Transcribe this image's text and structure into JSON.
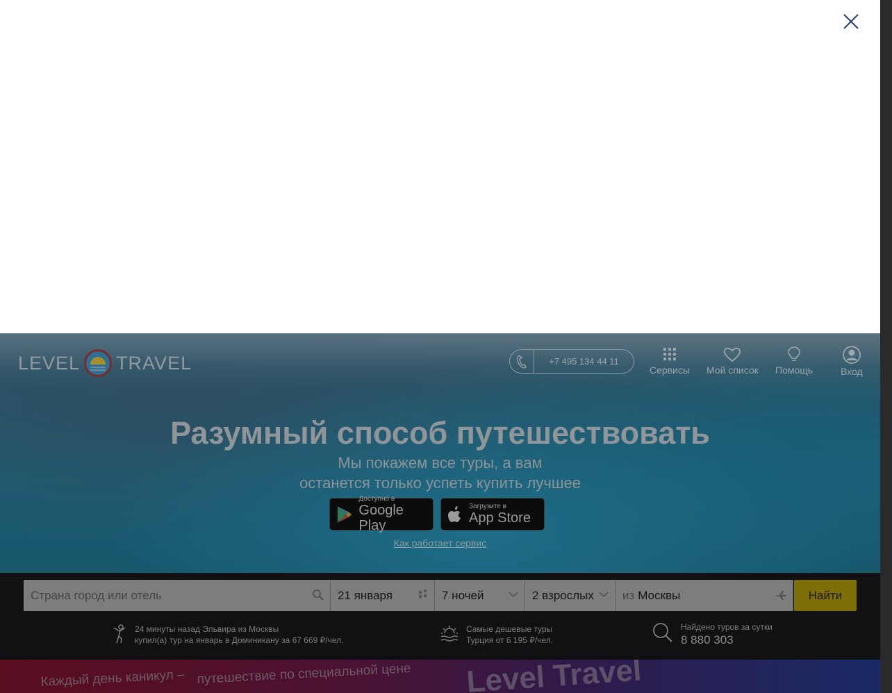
{
  "header": {
    "logo_left": "LEVEL",
    "logo_right": "TRAVEL",
    "phone": "+7 495 134 44 11",
    "nav": [
      {
        "label": "Сервисы",
        "icon": "grid-icon"
      },
      {
        "label": "Мой список",
        "icon": "heart-icon"
      },
      {
        "label": "Помощь",
        "icon": "lightbulb-icon"
      },
      {
        "label": "Вход",
        "icon": "user-icon"
      }
    ]
  },
  "hero": {
    "title": "Разумный способ путешествовать",
    "subtitle_line1": "Мы покажем все туры, а вам",
    "subtitle_line2": "останется только успеть купить лучшее",
    "google_play": {
      "small": "Доступно в",
      "big": "Google Play"
    },
    "app_store": {
      "small": "Загрузите в",
      "big": "App Store"
    },
    "how_link": "Как работает сервис"
  },
  "search": {
    "destination_placeholder": "Страна город или отель",
    "date": "21 января",
    "nights": "7 ночей",
    "guests": "2 взрослых",
    "from_prefix": "из",
    "from_city": "Москвы",
    "submit": "Найти"
  },
  "info": {
    "recent_line1": "24 минуты назад Эльвира из Москвы",
    "recent_line2": "купил(а) тур на январь в Доминикану за 67 669 ₽/чел.",
    "cheap_line1": "Самые дешевые туры",
    "cheap_line2": "Турция от 6 195 ₽/чел.",
    "found_label": "Найдено туров за сутки",
    "found_value": "8 880 303"
  },
  "promo": {
    "left_line1": "Каждый день каникул –",
    "left_line2": "путешествие по специальной цене",
    "right_text": "Level Travel"
  },
  "colors": {
    "overlay_dark": "#111113",
    "find_button": "#7e6e08",
    "hero_text": "#8f9599"
  }
}
